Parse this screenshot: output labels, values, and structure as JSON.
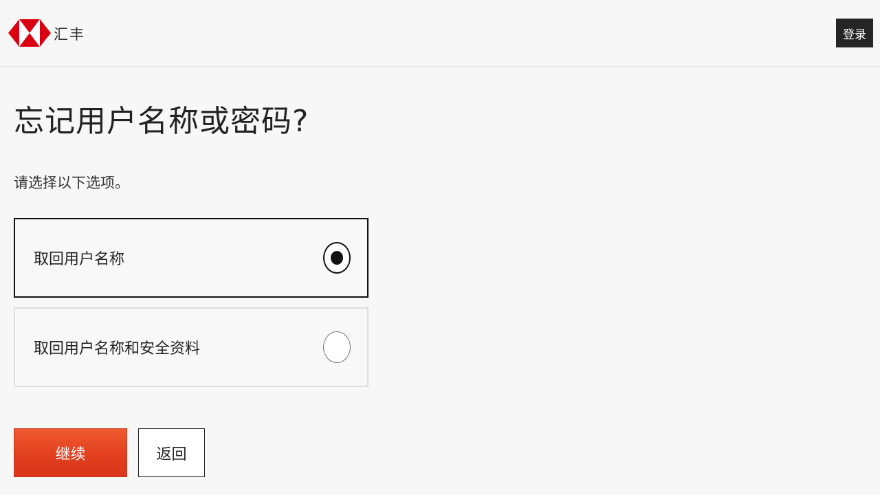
{
  "header": {
    "brand_name": "汇丰",
    "logo_icon": "hsbc-hexagon-logo",
    "login_label": "登录"
  },
  "main": {
    "title": "忘记用户名称或密码?",
    "instruction": "请选择以下选项。",
    "options": [
      {
        "label": "取回用户名称",
        "selected": true
      },
      {
        "label": "取回用户名称和安全资料",
        "selected": false
      }
    ],
    "continue_label": "继续",
    "back_label": "返回"
  },
  "colors": {
    "brand_red": "#db0011",
    "primary_button": "#e4431f",
    "login_button_bg": "#252525",
    "selected_border": "#111111",
    "unselected_border": "#dedede"
  }
}
